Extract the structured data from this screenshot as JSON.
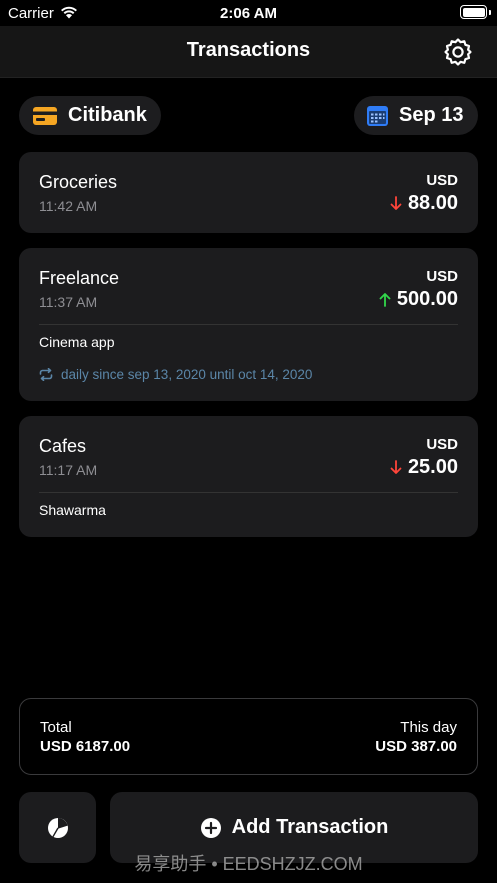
{
  "status_bar": {
    "carrier": "Carrier",
    "time": "2:06 AM"
  },
  "nav": {
    "title": "Transactions",
    "settings_icon": "gear-icon"
  },
  "account": {
    "label": "Citibank",
    "icon": "card-icon",
    "color": "#f5a623"
  },
  "date": {
    "label": "Sep 13",
    "icon": "calendar-icon",
    "color": "#2f7cf6"
  },
  "colors": {
    "expense": "#ff453a",
    "income": "#32d74b",
    "recurring": "#5b86a8"
  },
  "transactions": [
    {
      "category": "Groceries",
      "time": "11:42 AM",
      "currency": "USD",
      "direction": "down",
      "amount": "88.00",
      "note": "",
      "recurring": ""
    },
    {
      "category": "Freelance",
      "time": "11:37 AM",
      "currency": "USD",
      "direction": "up",
      "amount": "500.00",
      "note": "Cinema app",
      "recurring": "daily since sep 13, 2020 until oct 14, 2020"
    },
    {
      "category": "Cafes",
      "time": "11:17 AM",
      "currency": "USD",
      "direction": "down",
      "amount": "25.00",
      "note": "Shawarma",
      "recurring": ""
    }
  ],
  "totals": {
    "total_label": "Total",
    "total_value": "USD 6187.00",
    "day_label": "This day",
    "day_value": "USD 387.00"
  },
  "actions": {
    "chart_icon": "pie-chart-icon",
    "add_label": "Add Transaction",
    "add_icon": "plus-circle-icon"
  },
  "watermark": "易享助手 • EEDSHZJZ.COM"
}
